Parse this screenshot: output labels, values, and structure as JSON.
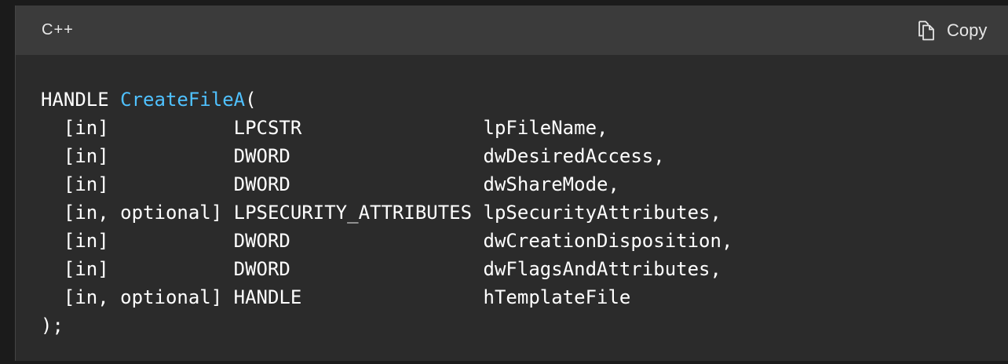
{
  "header": {
    "language": "C++",
    "copy_label": "Copy"
  },
  "code": {
    "return_type": "HANDLE ",
    "function_name": "CreateFileA",
    "open_paren": "(",
    "params": [
      "  [in]           LPCSTR                lpFileName,",
      "  [in]           DWORD                 dwDesiredAccess,",
      "  [in]           DWORD                 dwShareMode,",
      "  [in, optional] LPSECURITY_ATTRIBUTES lpSecurityAttributes,",
      "  [in]           DWORD                 dwCreationDisposition,",
      "  [in]           DWORD                 dwFlagsAndAttributes,",
      "  [in, optional] HANDLE                hTemplateFile"
    ],
    "close": ");"
  },
  "icons": {
    "copy": "copy-icon"
  },
  "colors": {
    "header_bg": "#3b3b3b",
    "code_bg": "#2b2b2b",
    "text": "#ffffff",
    "function_name": "#4fc1ff"
  }
}
